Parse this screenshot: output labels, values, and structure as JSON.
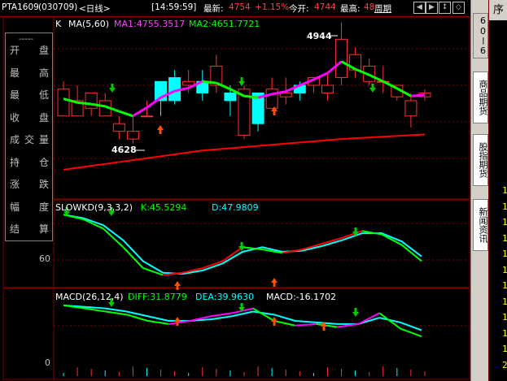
{
  "topbar": {
    "symbol": "PTA1609",
    "code": "(030709)",
    "period": "<日线>",
    "time": "[14:59:59]",
    "latest_label": "最新:",
    "latest_value": "4754",
    "change": "+1.15%",
    "open_label": "今开:",
    "open_value": "4744",
    "high_label": "最高:",
    "high_value": "48",
    "cycle_label": "周期"
  },
  "right_tabs": {
    "t1": "60ー6",
    "t2": "商品期货",
    "t3": "股指期货",
    "t4": "新闻资讯"
  },
  "far_column": {
    "header": "序",
    "digits": [
      "1",
      "1",
      "1",
      "1",
      "1",
      "1",
      "1",
      "1",
      "1",
      "1",
      "1",
      "2"
    ]
  },
  "info_panel": {
    "dash": "-----",
    "rows": [
      [
        "开",
        "盘"
      ],
      [
        "最",
        "高"
      ],
      [
        "最",
        "低"
      ],
      [
        "收",
        "盘"
      ],
      [
        "成",
        "交",
        "量"
      ],
      [
        "持",
        "仓"
      ],
      [
        "涨",
        "跌"
      ],
      [
        "幅",
        "度"
      ],
      [
        "结",
        "算"
      ]
    ]
  },
  "main_panel": {
    "k_label": "K",
    "ma_label": "MA(5,60)",
    "ma1": "MA1:4755.3517",
    "ma2": "MA2:4651.7721",
    "high_marker": "4944",
    "low_marker": "4628"
  },
  "kd_panel": {
    "name": "SLOWKD(9,3,3,2)",
    "k": "K:45.5294",
    "d": "D:47.9809",
    "axis": "60"
  },
  "macd_panel": {
    "name": "MACD(26,12,4)",
    "diff": "DIFF:31.8779",
    "dea": "DEA:39.9630",
    "macd": "MACD:-16.1702",
    "axis": "0"
  },
  "chart_data": {
    "type": "candlestick",
    "candles_ohlc": [
      [
        4700,
        4770,
        4790,
        4760
      ],
      [
        4700,
        4740,
        4780,
        4700
      ],
      [
        4720,
        4760,
        4760,
        4700
      ],
      [
        4700,
        4740,
        4760,
        4700
      ],
      [
        4660,
        4680,
        4700,
        4640
      ],
      [
        4640,
        4660,
        4700,
        4628
      ],
      [
        4700,
        4700,
        4740,
        4700
      ],
      [
        4790,
        4740,
        4790,
        4700
      ],
      [
        4800,
        4740,
        4820,
        4730
      ],
      [
        4780,
        4790,
        4820,
        4760
      ],
      [
        4790,
        4760,
        4820,
        4740
      ],
      [
        4780,
        4830,
        4860,
        4760
      ],
      [
        4760,
        4740,
        4780,
        4700
      ],
      [
        4650,
        4770,
        4780,
        4640
      ],
      [
        4760,
        4680,
        4760,
        4660
      ],
      [
        4720,
        4770,
        4800,
        4720
      ],
      [
        4750,
        4760,
        4800,
        4730
      ],
      [
        4780,
        4760,
        4790,
        4740
      ],
      [
        4780,
        4800,
        4800,
        4760
      ],
      [
        4760,
        4780,
        4810,
        4740
      ],
      [
        4800,
        4900,
        4944,
        4780
      ],
      [
        4820,
        4860,
        4880,
        4800
      ],
      [
        4790,
        4830,
        4850,
        4780
      ],
      [
        4790,
        4790,
        4830,
        4760
      ],
      [
        4750,
        4780,
        4780,
        4740
      ],
      [
        4700,
        4740,
        4760,
        4670
      ],
      [
        4750,
        4760,
        4770,
        4740
      ]
    ],
    "ma1_values": [
      4745,
      4735,
      4731,
      4725,
      4712,
      4700,
      4722,
      4748,
      4765,
      4773,
      4790,
      4786,
      4770,
      4752,
      4748,
      4757,
      4764,
      4780,
      4795,
      4812,
      4842,
      4822,
      4807,
      4790,
      4772,
      4752,
      4755
    ],
    "ma2_values": [
      4560,
      4565,
      4570,
      4575,
      4580,
      4585,
      4590,
      4595,
      4600,
      4605,
      4610,
      4613,
      4616,
      4619,
      4622,
      4625,
      4628,
      4631,
      4634,
      4637,
      4640,
      4642,
      4644,
      4646,
      4648,
      4650,
      4652
    ],
    "kd_k": [
      80,
      76,
      68,
      52,
      34,
      28,
      30,
      34,
      40,
      52,
      50,
      47,
      50,
      55,
      60,
      66,
      63,
      54,
      40
    ],
    "kd_d": [
      80,
      77,
      71,
      58,
      40,
      30,
      29,
      32,
      38,
      48,
      52,
      48,
      49,
      53,
      58,
      64,
      64,
      57,
      44
    ],
    "macd_diff": [
      40,
      38,
      36,
      34,
      30,
      28,
      30,
      33,
      35,
      38,
      30,
      27,
      28,
      26,
      28,
      35,
      25,
      20
    ],
    "macd_dea": [
      40,
      39,
      38,
      36,
      33,
      30,
      30,
      31,
      33,
      36,
      34,
      30,
      29,
      28,
      28,
      32,
      29,
      24
    ]
  }
}
